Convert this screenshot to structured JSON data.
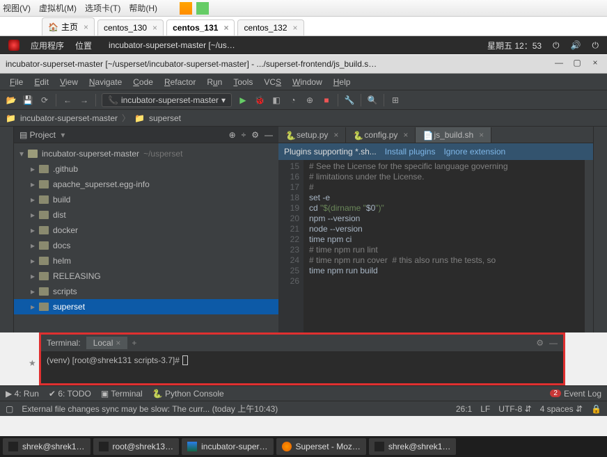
{
  "host_menu": {
    "view": "视图(V)",
    "vm": "虚拟机(M)",
    "tabs": "选项卡(T)",
    "help": "帮助(H)"
  },
  "host_tabs": {
    "home": "主页",
    "t1": "centos_130",
    "t2": "centos_131",
    "t3": "centos_132"
  },
  "gnome": {
    "apps": "应用程序",
    "places": "位置",
    "wintitle": "incubator-superset-master [~/us…",
    "datetime": "星期五 12：53"
  },
  "ide_title": "incubator-superset-master [~/usperset/incubator-superset-master] - .../superset-frontend/js_build.s…",
  "menu": {
    "file": "File",
    "edit": "Edit",
    "view": "View",
    "navigate": "Navigate",
    "code": "Code",
    "refactor": "Refactor",
    "run": "Run",
    "tools": "Tools",
    "vcs": "VCS",
    "window": "Window",
    "help": "Help"
  },
  "run_config": "incubator-superset-master",
  "breadcrumb": {
    "root": "incubator-superset-master",
    "child": "superset"
  },
  "project": {
    "label": "Project",
    "root": "incubator-superset-master",
    "root_path": "~/usperset",
    "items": [
      ".github",
      "apache_superset.egg-info",
      "build",
      "dist",
      "docker",
      "docs",
      "helm",
      "RELEASING",
      "scripts",
      "superset"
    ]
  },
  "editor_tabs": {
    "t1": "setup.py",
    "t2": "config.py",
    "t3": "js_build.sh"
  },
  "banner": {
    "msg": "Plugins supporting *.sh...",
    "install": "Install plugins",
    "ignore": "Ignore extension"
  },
  "code": {
    "line_start": 15,
    "lines": [
      "# See the License for the specific language governing",
      "# limitations under the License.",
      "#",
      "set -e",
      "cd \"$(dirname \"$0\")\"",
      "npm --version",
      "node --version",
      "time npm ci",
      "# time npm run lint",
      "# time npm run cover  # this also runs the tests, so",
      "time npm run build",
      ""
    ]
  },
  "terminal": {
    "title": "Terminal:",
    "tab": "Local",
    "prompt": "(venv) [root@shrek131 scripts-3.7]#"
  },
  "bottom_tools": {
    "run": "4: Run",
    "todo": "6: TODO",
    "terminal": "Terminal",
    "python": "Python Console",
    "event_log": "Event Log",
    "badge": "2"
  },
  "status": {
    "msg": "External file changes sync may be slow: The curr... (today 上午10:43)",
    "pos": "26:1",
    "lf": "LF",
    "enc": "UTF-8",
    "indent": "4 spaces"
  },
  "taskbar": {
    "t1": "shrek@shrek1…",
    "t2": "root@shrek13…",
    "t3": "incubator-super…",
    "t4": "Superset - Moz…",
    "t5": "shrek@shrek1…"
  },
  "watermark": ""
}
